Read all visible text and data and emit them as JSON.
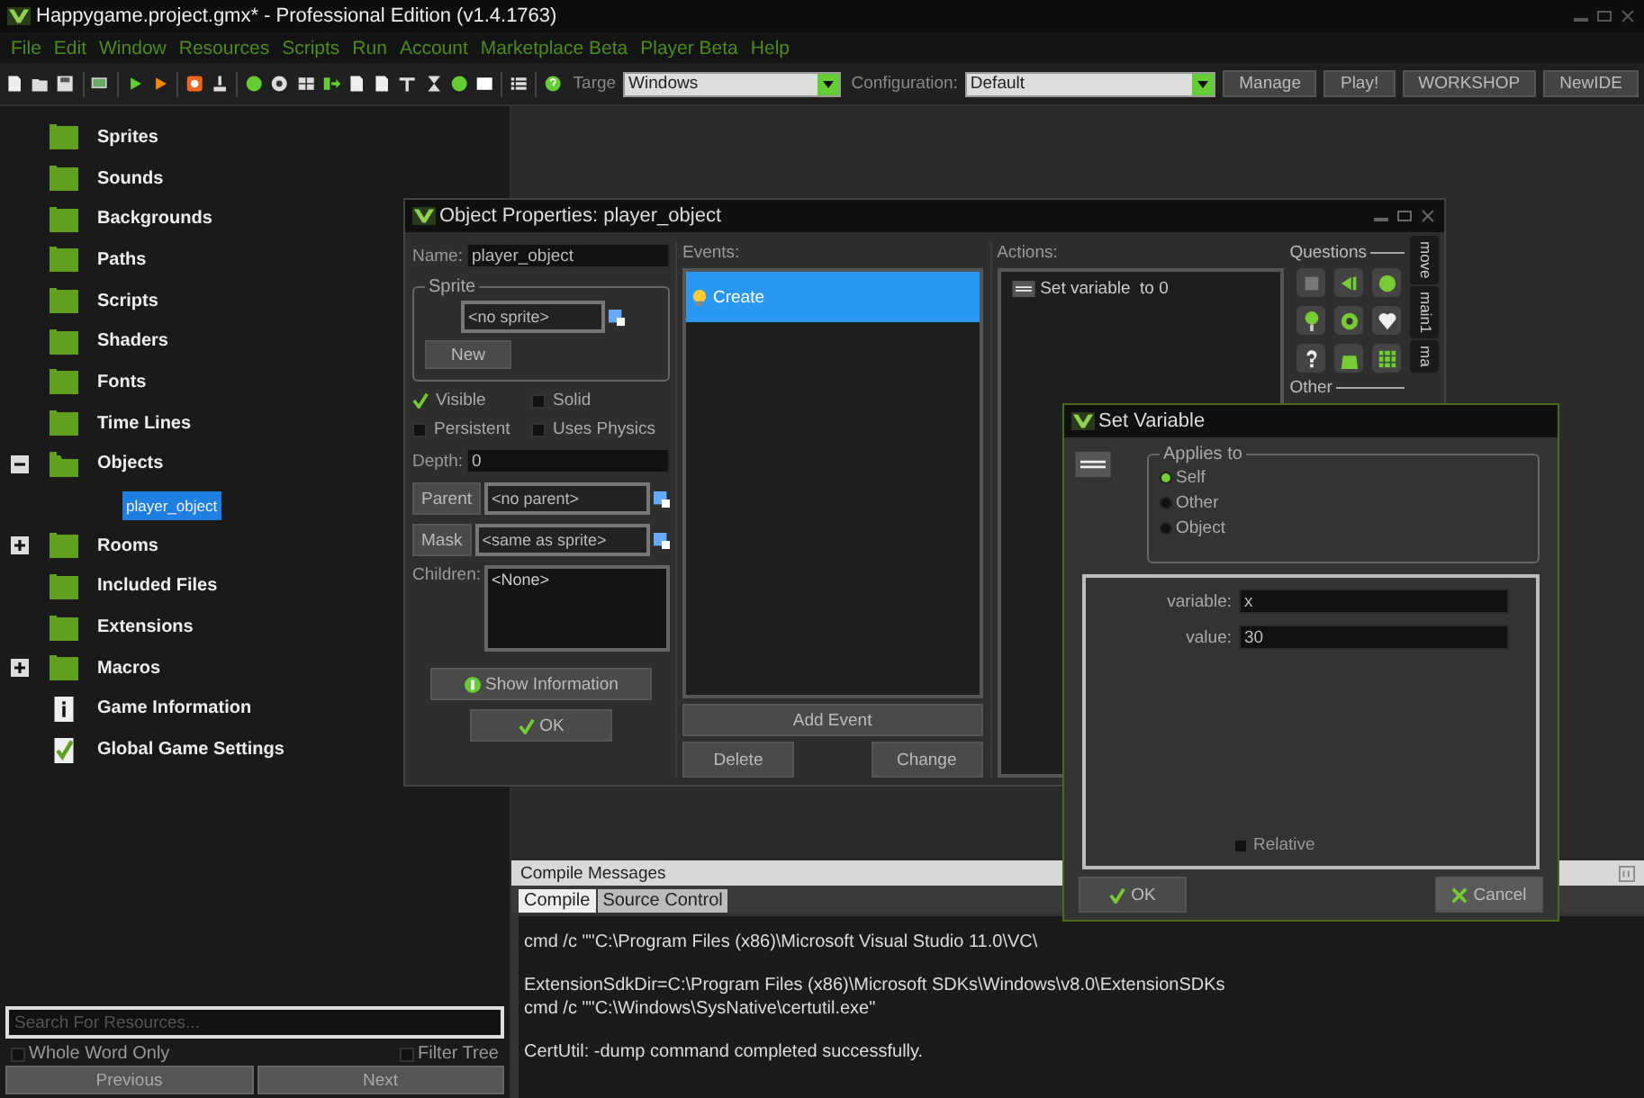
{
  "window": {
    "title": "Happygame.project.gmx*  -  Professional Edition (v1.4.1763)"
  },
  "menu": [
    "File",
    "Edit",
    "Window",
    "Resources",
    "Scripts",
    "Run",
    "Account",
    "Marketplace Beta",
    "Player Beta",
    "Help"
  ],
  "toolbar": {
    "target_label": "Targe",
    "target": "Windows",
    "configuration_label": "Configuration:",
    "configuration": "Default",
    "buttons": [
      "Manage",
      "Play!",
      "WORKSHOP",
      "NewIDE"
    ]
  },
  "resource_tree": [
    {
      "label": "Sprites",
      "kind": "folder"
    },
    {
      "label": "Sounds",
      "kind": "folder"
    },
    {
      "label": "Backgrounds",
      "kind": "folder"
    },
    {
      "label": "Paths",
      "kind": "folder"
    },
    {
      "label": "Scripts",
      "kind": "folder"
    },
    {
      "label": "Shaders",
      "kind": "folder"
    },
    {
      "label": "Fonts",
      "kind": "folder"
    },
    {
      "label": "Time Lines",
      "kind": "folder"
    },
    {
      "label": "Objects",
      "kind": "folder",
      "expanded": true,
      "children": [
        {
          "label": "player_object",
          "selected": true
        }
      ]
    },
    {
      "label": "Rooms",
      "kind": "folder",
      "expanded": false
    },
    {
      "label": "Included Files",
      "kind": "folder"
    },
    {
      "label": "Extensions",
      "kind": "folder"
    },
    {
      "label": "Macros",
      "kind": "folder",
      "expanded": false
    },
    {
      "label": "Game Information",
      "kind": "info"
    },
    {
      "label": "Global Game Settings",
      "kind": "settings"
    }
  ],
  "resource_search": {
    "placeholder": "Search For Resources...",
    "options": [
      {
        "label": "Whole Word Only",
        "checked": false
      },
      {
        "label": "Filter Tree",
        "checked": false
      }
    ],
    "previous_button": "Previous",
    "next_button": "Next"
  },
  "object_properties": {
    "title": "Object Properties: player_object",
    "name_label": "Name:",
    "name": "player_object",
    "sprite_group": "Sprite",
    "sprite": "<no sprite>",
    "new_button": "New",
    "flags": [
      {
        "label": "Visible",
        "checked": true
      },
      {
        "label": "Solid",
        "checked": false
      },
      {
        "label": "Persistent",
        "checked": false
      },
      {
        "label": "Uses Physics",
        "checked": false
      }
    ],
    "depth_label": "Depth:",
    "depth": "0",
    "parent_button": "Parent",
    "parent": "<no parent>",
    "mask_button": "Mask",
    "mask": "<same as sprite>",
    "children_label": "Children:",
    "children": "<None>",
    "info_button": "Show Information",
    "ok_button": "OK",
    "events_label": "Events:",
    "events": [
      {
        "label": "Create",
        "selected": true
      }
    ],
    "add_event_button": "Add Event",
    "delete_button": "Delete",
    "change_button": "Change",
    "actions_label": "Actions:",
    "actions": [
      {
        "label": "Set variable  to 0"
      }
    ],
    "palette_groups": [
      "Questions",
      "Other"
    ],
    "side_tabs": [
      "move",
      "main1",
      "ma"
    ]
  },
  "set_variable": {
    "title": "Set Variable",
    "applies_label": "Applies to",
    "applies": [
      {
        "label": "Self",
        "selected": true
      },
      {
        "label": "Other",
        "selected": false
      },
      {
        "label": "Object",
        "selected": false
      }
    ],
    "fields": [
      {
        "label": "variable:",
        "value": "x"
      },
      {
        "label": "value:",
        "value": "30"
      }
    ],
    "relative": {
      "label": "Relative",
      "checked": false
    },
    "ok_button": "OK",
    "cancel_button": "Cancel"
  },
  "compile_messages": {
    "title": "Compile Messages",
    "tabs": [
      {
        "label": "Compile",
        "selected": true
      },
      {
        "label": "Source Control",
        "selected": false
      }
    ],
    "blocks": [
      [
        "cmd /c \"\"C:\\Program Files (x86)\\Microsoft Visual Studio 11.0\\VC\\"
      ],
      [
        "ExtensionSdkDir=C:\\Program Files (x86)\\Microsoft SDKs\\Windows\\v8.0\\ExtensionSDKs",
        "cmd /c \"\"C:\\Windows\\SysNative\\certutil.exe\""
      ],
      [
        "CertUtil: -dump command completed successfully."
      ]
    ]
  }
}
